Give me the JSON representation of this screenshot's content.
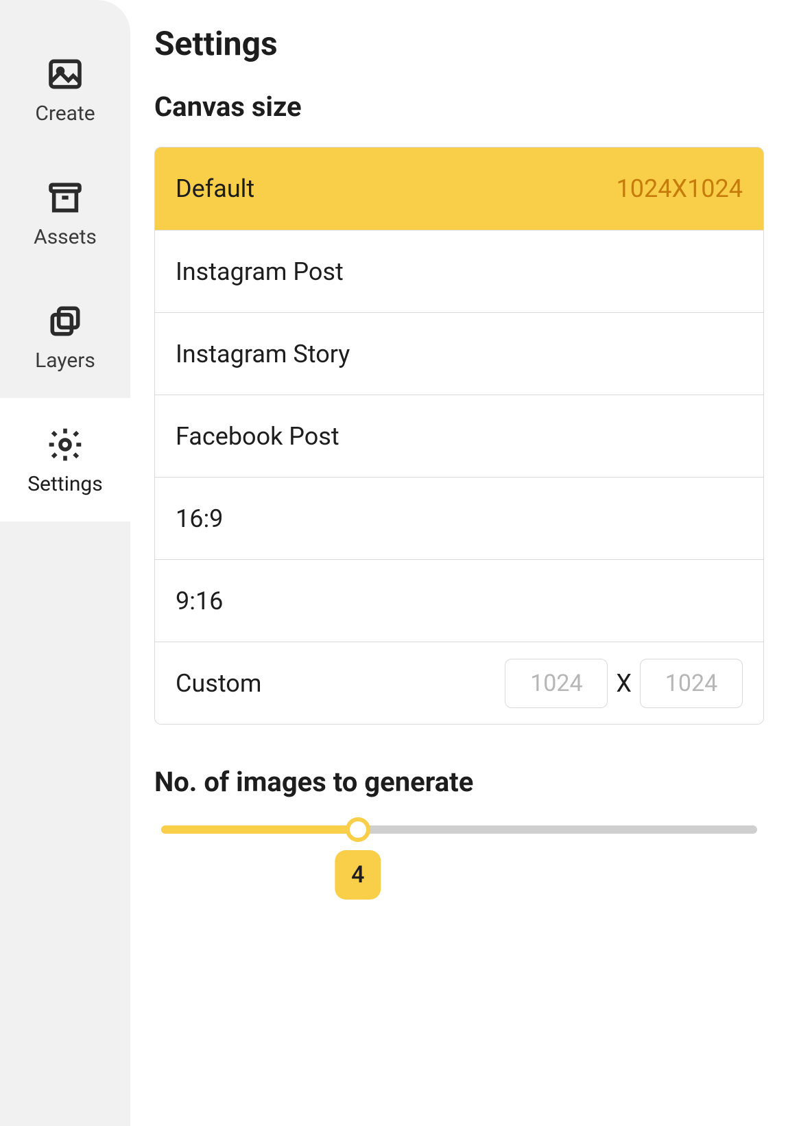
{
  "sidebar": {
    "items": [
      {
        "label": "Create",
        "icon": "image-icon"
      },
      {
        "label": "Assets",
        "icon": "archive-icon"
      },
      {
        "label": "Layers",
        "icon": "layers-icon"
      },
      {
        "label": "Settings",
        "icon": "gear-icon"
      }
    ],
    "active_index": 3
  },
  "page": {
    "title": "Settings"
  },
  "canvas_size": {
    "section_title": "Canvas size",
    "selected_index": 0,
    "options": [
      {
        "label": "Default",
        "dims": "1024X1024"
      },
      {
        "label": "Instagram Post",
        "dims": ""
      },
      {
        "label": "Instagram Story",
        "dims": ""
      },
      {
        "label": "Facebook Post",
        "dims": ""
      },
      {
        "label": "16:9",
        "dims": ""
      },
      {
        "label": "9:16",
        "dims": ""
      }
    ],
    "custom": {
      "label": "Custom",
      "width_placeholder": "1024",
      "height_placeholder": "1024",
      "separator": "X"
    }
  },
  "images_to_generate": {
    "section_title": "No. of images to generate",
    "value": 4,
    "min": 1,
    "max": 10,
    "percent": 33
  }
}
